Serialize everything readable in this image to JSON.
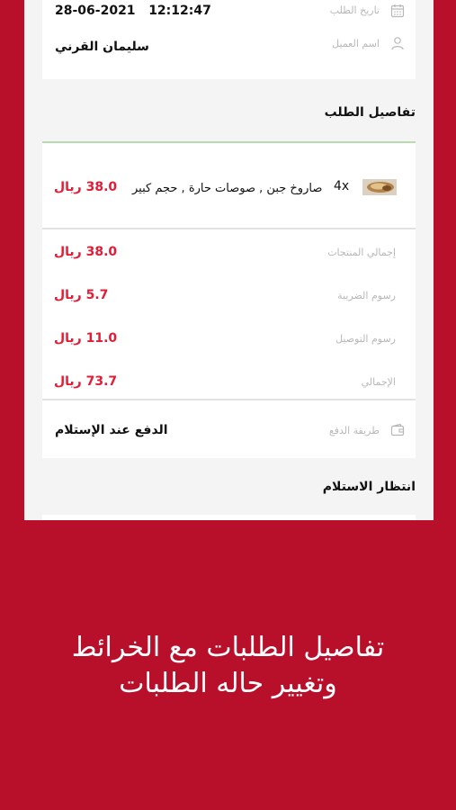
{
  "order_info": {
    "date_label": "تاريخ الطلب",
    "date_value": "28-06-2021",
    "time_value": "12:12:47",
    "customer_label": "اسم العميل",
    "customer_value": "سليمان القرني"
  },
  "order_details": {
    "title": "تفاصيل الطلب",
    "item": {
      "quantity": "4x",
      "name": "صاروخ جبن , صوصات حارة , حجم كبير",
      "price": "38.0 ريال"
    }
  },
  "totals": [
    {
      "label": "إجمالي المنتجات",
      "value": "38.0 ريال"
    },
    {
      "label": "رسوم الضريبة",
      "value": "5.7 ريال"
    },
    {
      "label": "رسوم التوصيل",
      "value": "11.0 ريال"
    },
    {
      "label": "الإجمالي",
      "value": "73.7 ريال"
    }
  ],
  "payment": {
    "label": "طريقة الدفع",
    "value": "الدفع عند الإستلام"
  },
  "status": {
    "title": "انتظار الاستلام"
  },
  "promo": {
    "line1": "تفاصيل الطلبات مع الخرائط",
    "line2": "وتغيير حاله الطلبات"
  },
  "colors": {
    "background": "#b80f2b",
    "price": "#e31b35",
    "accent_line": "#b8dcae"
  },
  "icons": [
    "calendar-icon",
    "user-icon",
    "wallet-icon"
  ]
}
